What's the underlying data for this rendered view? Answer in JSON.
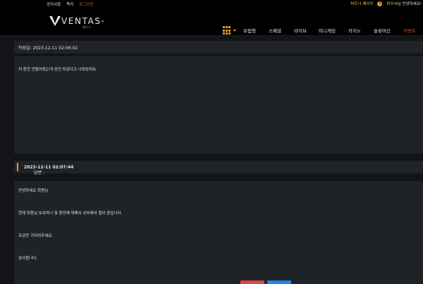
{
  "topbar": {
    "links": [
      "공지사항",
      "쪽지",
      "로그아웃"
    ],
    "partner": "파트너 페이지",
    "greeting_name": "파우씨",
    "greeting_rest": "님 안녕하세요!"
  },
  "header": {
    "logo_text": "VENTAS",
    "logo_sub": "벤타스",
    "nav": [
      "유럽형",
      "스페셜",
      "라이브",
      "미니게임",
      "카지노",
      "슬롯머신",
      "이벤트"
    ]
  },
  "post": {
    "date_label": "작성일: 2023-12-11 02:06:02",
    "question": "저 환전 안들어왔는데 승인 되었다고 나와있어요"
  },
  "answer": {
    "label": "답변 - ",
    "date": "2023-12-11 02:07:44",
    "lines": [
      "안녕하세요 회원님",
      "현재 회원님 보유머니 및 환전에 대해서 상부에서 협의 중입니다.",
      "조금만 기다려주세요.",
      "감사합니다."
    ]
  },
  "colors": {
    "accent": "#e39b2a",
    "active_nav": "#e8402f",
    "button_red": "#d9434f",
    "button_blue": "#1f84e6"
  }
}
